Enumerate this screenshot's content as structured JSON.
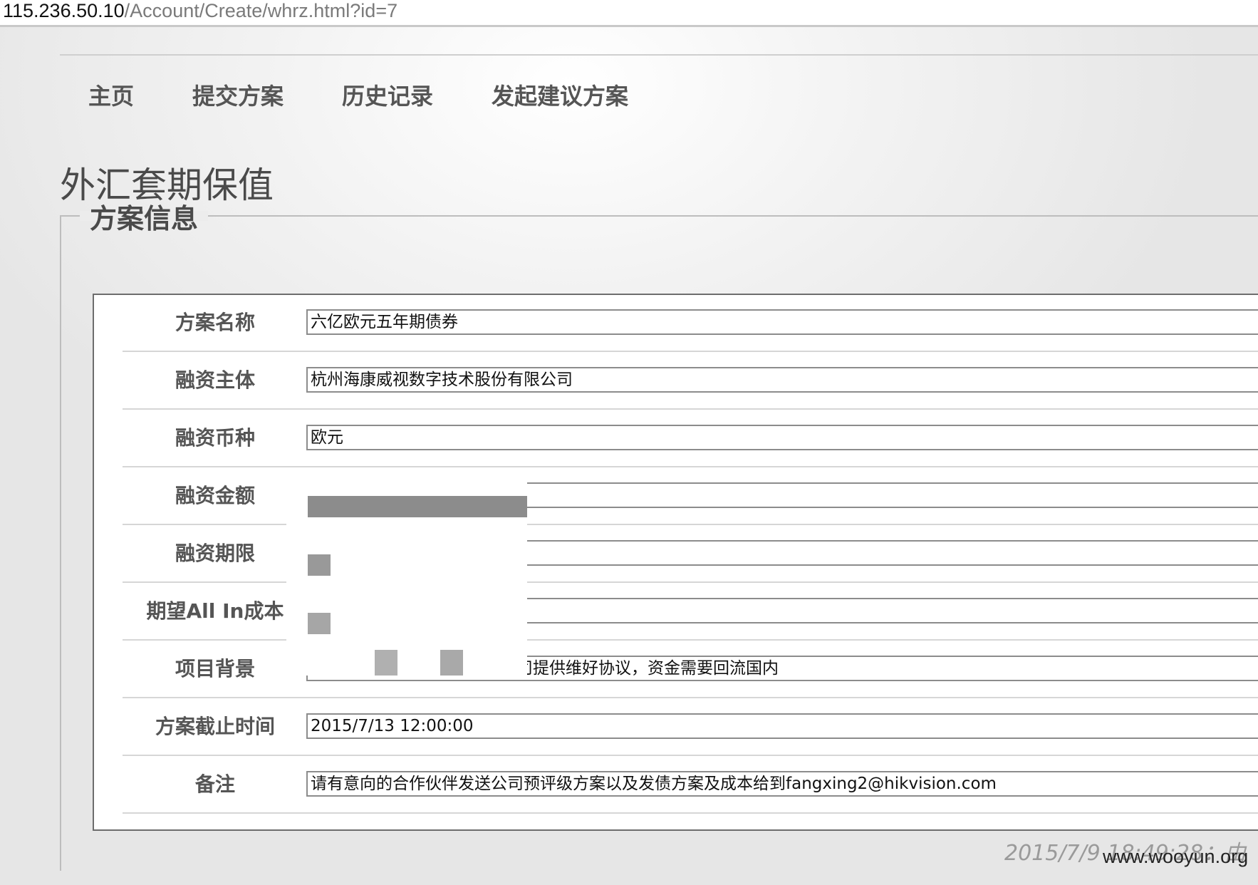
{
  "address_bar": {
    "host": "115.236.50.10",
    "path": "/Account/Create/whrz.html?id=7"
  },
  "nav": {
    "items": [
      {
        "label": "主页"
      },
      {
        "label": "提交方案"
      },
      {
        "label": "历史记录"
      },
      {
        "label": "发起建议方案"
      }
    ]
  },
  "page": {
    "title": "外汇套期保值",
    "legend": "方案信息"
  },
  "form": {
    "rows": [
      {
        "label": "方案名称",
        "value": "六亿欧元五年期债券"
      },
      {
        "label": "融资主体",
        "value": "杭州海康威视数字技术股份有限公司"
      },
      {
        "label": "融资币种",
        "value": "欧元"
      },
      {
        "label": "融资金额",
        "value": ""
      },
      {
        "label": "融资期限",
        "value": ""
      },
      {
        "label": "期望All In成本",
        "value": ""
      },
      {
        "label": "项目背景",
        "value": "公司提供维好协议，资金需要回流国内"
      },
      {
        "label": "方案截止时间",
        "value": "2015/7/13 12:00:00"
      },
      {
        "label": "备注",
        "value": "请有意向的合作伙伴发送公司预评级方案以及发债方案及成本给到fangxing2@hikvision.com"
      }
    ]
  },
  "footer": {
    "timestamp": "2015/7/9 18:49:28：由",
    "watermark": "www.wooyun.org"
  }
}
